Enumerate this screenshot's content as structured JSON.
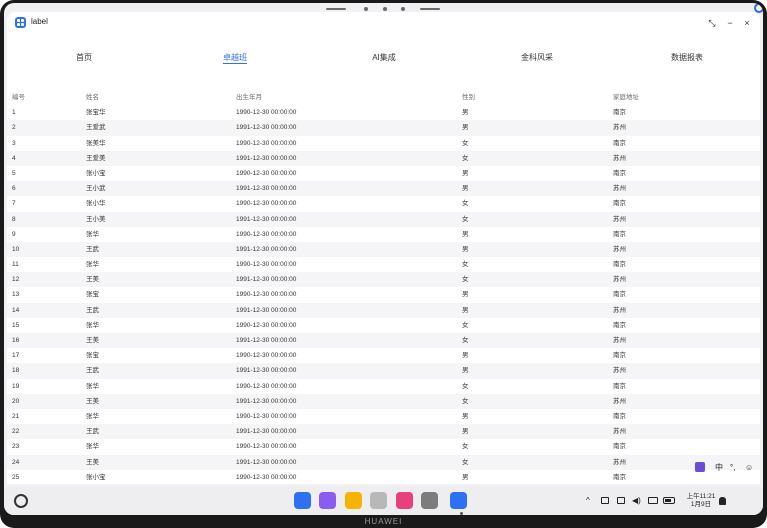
{
  "window": {
    "title": "label",
    "controls": {
      "restore": "⤡",
      "minimize": "−",
      "close": "×"
    }
  },
  "tabs": [
    "首页",
    "卓越班",
    "AI集成",
    "金科风采",
    "数据报表"
  ],
  "active_tab": 1,
  "table": {
    "headers": [
      "编号",
      "姓名",
      "出生年月",
      "性别",
      "家庭地址"
    ],
    "rows": [
      [
        "1",
        "张宝华",
        "1990-12-30 00:00:00",
        "男",
        "南京"
      ],
      [
        "2",
        "王爱武",
        "1991-12-30 00:00:00",
        "男",
        "苏州"
      ],
      [
        "3",
        "张美华",
        "1990-12-30 00:00:00",
        "女",
        "南京"
      ],
      [
        "4",
        "王爱美",
        "1991-12-30 00:00:00",
        "女",
        "苏州"
      ],
      [
        "5",
        "张小宝",
        "1990-12-30 00:00:00",
        "男",
        "南京"
      ],
      [
        "6",
        "王小武",
        "1991-12-30 00:00:00",
        "男",
        "苏州"
      ],
      [
        "7",
        "张小华",
        "1990-12-30 00:00:00",
        "女",
        "南京"
      ],
      [
        "8",
        "王小美",
        "1991-12-30 00:00:00",
        "女",
        "苏州"
      ],
      [
        "9",
        "张华",
        "1990-12-30 00:00:00",
        "男",
        "南京"
      ],
      [
        "10",
        "王武",
        "1991-12-30 00:00:00",
        "男",
        "苏州"
      ],
      [
        "11",
        "张华",
        "1990-12-30 00:00:00",
        "女",
        "南京"
      ],
      [
        "12",
        "王美",
        "1991-12-30 00:00:00",
        "女",
        "苏州"
      ],
      [
        "13",
        "张宝",
        "1990-12-30 00:00:00",
        "男",
        "南京"
      ],
      [
        "14",
        "王武",
        "1991-12-30 00:00:00",
        "男",
        "苏州"
      ],
      [
        "15",
        "张华",
        "1990-12-30 00:00:00",
        "女",
        "南京"
      ],
      [
        "16",
        "王美",
        "1991-12-30 00:00:00",
        "女",
        "苏州"
      ],
      [
        "17",
        "张宝",
        "1990-12-30 00:00:00",
        "男",
        "南京"
      ],
      [
        "18",
        "王武",
        "1991-12-30 00:00:00",
        "男",
        "苏州"
      ],
      [
        "19",
        "张华",
        "1990-12-30 00:00:00",
        "女",
        "南京"
      ],
      [
        "20",
        "王美",
        "1991-12-30 00:00:00",
        "女",
        "苏州"
      ],
      [
        "21",
        "张华",
        "1990-12-30 00:00:00",
        "男",
        "南京"
      ],
      [
        "22",
        "王武",
        "1991-12-30 00:00:00",
        "男",
        "苏州"
      ],
      [
        "23",
        "张华",
        "1990-12-30 00:00:00",
        "女",
        "南京"
      ],
      [
        "24",
        "王美",
        "1991-12-30 00:00:00",
        "女",
        "苏州"
      ],
      [
        "25",
        "张小宝",
        "1990-12-30 00:00:00",
        "男",
        "南京"
      ]
    ]
  },
  "ime": {
    "lang": "中",
    "punct": "°,",
    "emoji": "☺"
  },
  "dock": {
    "apps": [
      {
        "name": "app-grid-icon",
        "color": "#2f6ff2"
      },
      {
        "name": "multi-window-icon",
        "color": "#8a5cf0"
      },
      {
        "name": "files-icon",
        "color": "#f5b400"
      },
      {
        "name": "trash-icon",
        "color": "#b8b8b8"
      },
      {
        "name": "gallery-icon",
        "color": "#e8407a"
      },
      {
        "name": "settings-icon",
        "color": "#7c7c7c"
      },
      {
        "name": "label-app-icon",
        "color": "#2f6ff2"
      }
    ]
  },
  "statusbar": {
    "time": "上午11:21",
    "date": "1月9日",
    "icons": {
      "chevron": "^",
      "volume": "◀)"
    }
  },
  "device": {
    "brand": "HUAWEI"
  },
  "colors": {
    "accent": "#2f6ff2",
    "row_alt": "#f5f5f7"
  }
}
